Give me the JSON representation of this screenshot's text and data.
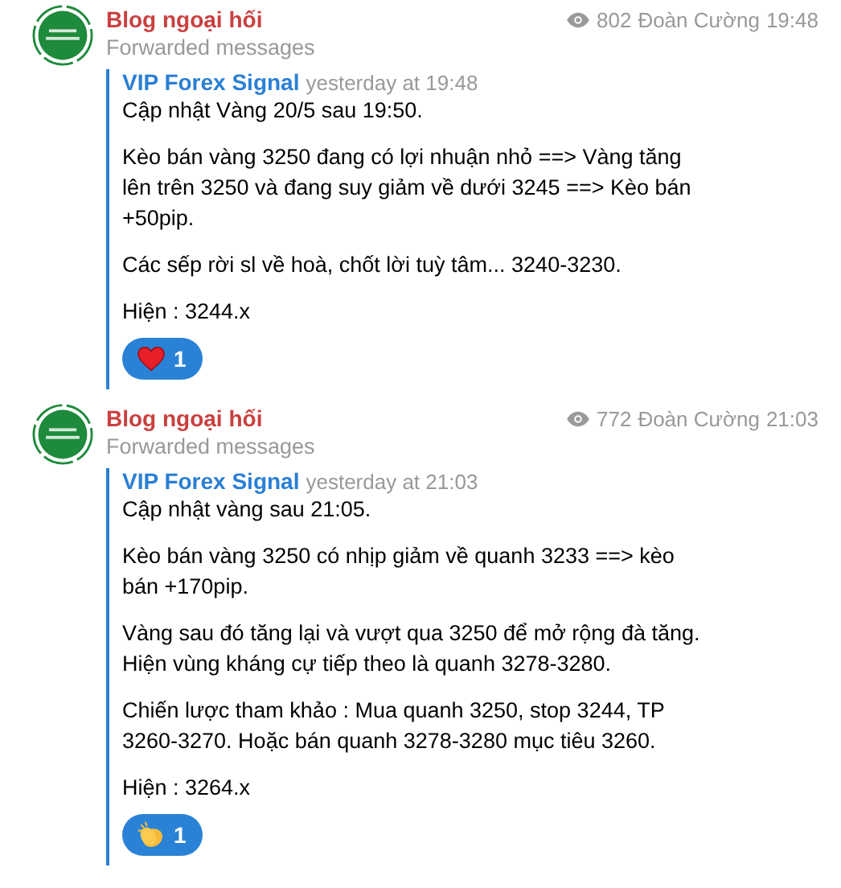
{
  "messages": [
    {
      "channel": "Blog ngoại hối",
      "subtitle": "Forwarded messages",
      "views": "802",
      "author": "Đoàn Cường",
      "time": "19:48",
      "forward_from": "VIP Forex Signal",
      "forward_time": "yesterday at 19:48",
      "paragraphs": [
        "Cập nhật Vàng 20/5 sau 19:50.",
        "Kèo bán vàng 3250 đang có lợi nhuận nhỏ ==> Vàng tăng\nlên trên 3250 và đang suy giảm về dưới 3245 ==> Kèo bán\n+50pip.",
        "Các sếp rời sl về hoà, chốt lời tuỳ tâm... 3240-3230.",
        "Hiện : 3244.x"
      ],
      "reactions": [
        {
          "kind": "heart",
          "count": "1",
          "selected": true
        }
      ]
    },
    {
      "channel": "Blog ngoại hối",
      "subtitle": "Forwarded messages",
      "views": "772",
      "author": "Đoàn Cường",
      "time": "21:03",
      "forward_from": "VIP Forex Signal",
      "forward_time": "yesterday at 21:03",
      "paragraphs": [
        "Cập nhật vàng sau 21:05.",
        "Kèo bán vàng 3250 có nhịp giảm về quanh 3233 ==> kèo\nbán +170pip.",
        "Vàng sau đó tăng lại và vượt qua 3250 để mở rộng đà tăng.\nHiện vùng kháng cự tiếp theo là quanh 3278-3280.",
        "Chiến lược tham khảo : Mua quanh 3250, stop 3244, TP\n3260-3270. Hoặc bán quanh 3278-3280 mục tiêu 3260.",
        "Hiện : 3264.x"
      ],
      "reactions": [
        {
          "kind": "clap",
          "count": "1",
          "selected": true
        }
      ]
    }
  ]
}
